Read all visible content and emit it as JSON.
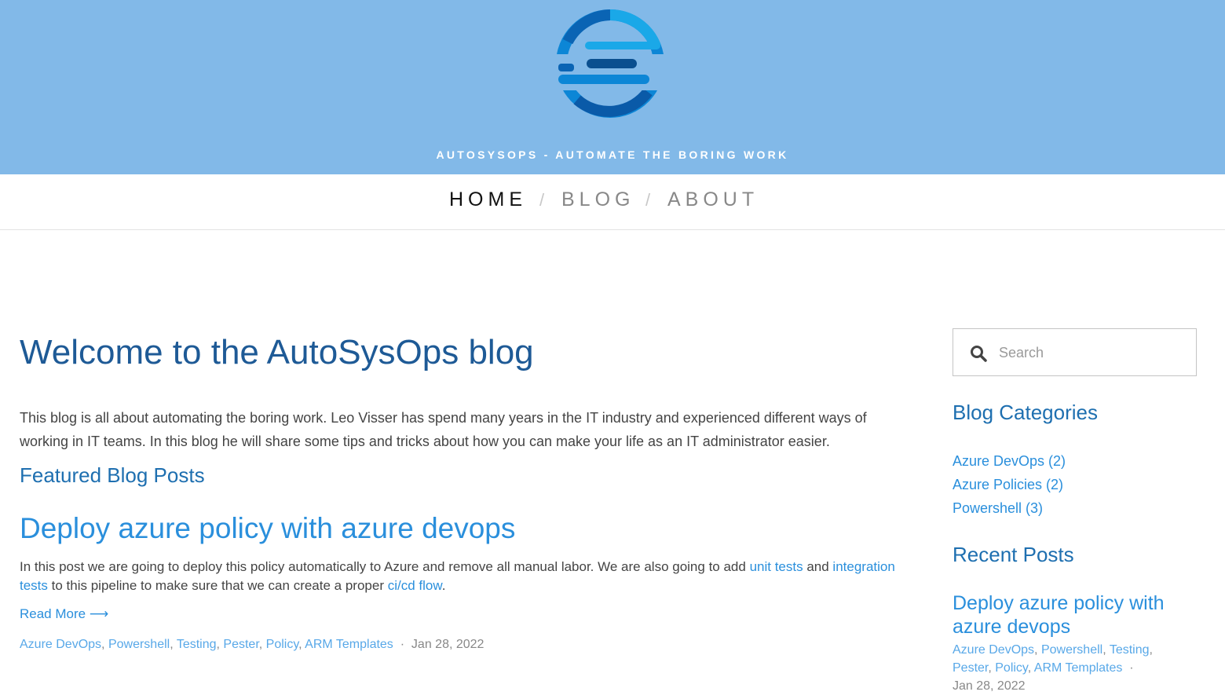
{
  "header": {
    "tagline": "AUTOSYSOPS - AUTOMATE THE BORING WORK",
    "logo_icon": "autosysops-logo-icon",
    "background": "#82b9e8"
  },
  "nav": {
    "items": [
      {
        "label": "HOME",
        "active": true
      },
      {
        "label": "BLOG",
        "active": false
      },
      {
        "label": "ABOUT",
        "active": false
      }
    ],
    "separator": "/"
  },
  "main": {
    "title": "Welcome to the AutoSysOps blog",
    "intro": "This blog is all about automating the boring work. Leo Visser has spend many years in the IT industry and experienced different ways of working in IT teams. In this blog he will share some tips and tricks about how you can make your life as an IT administrator easier.",
    "featured_heading": "Featured Blog Posts",
    "post": {
      "title": "Deploy azure policy with azure devops",
      "excerpt_parts": [
        "In this post we are going to deploy this policy automatically to Azure and remove all manual labor. We are also going to add ",
        "unit tests",
        " and ",
        "integration tests",
        " to this pipeline to make sure that we can create a proper ",
        "ci/cd flow",
        "."
      ],
      "read_more": "Read More ⟶",
      "tags": [
        "Azure DevOps",
        "Powershell",
        "Testing",
        "Pester",
        "Policy",
        "ARM Templates"
      ],
      "dot": "·",
      "date": "Jan 28, 2022"
    }
  },
  "sidebar": {
    "search": {
      "placeholder": "Search",
      "icon": "search-icon"
    },
    "categories_heading": "Blog Categories",
    "categories": [
      "Azure DevOps (2)",
      "Azure Policies (2)",
      "Powershell (3)"
    ],
    "recent_heading": "Recent Posts",
    "recent_post": {
      "title": "Deploy azure policy with azure devops",
      "tags": [
        "Azure DevOps",
        "Powershell",
        "Testing",
        "Pester",
        "Policy",
        "ARM Templates"
      ],
      "date": "Jan 28, 2022"
    }
  },
  "colors": {
    "accent": "#2a8fdc",
    "heading_dark": "#1e5a96",
    "tag_link": "#58a8e8"
  }
}
